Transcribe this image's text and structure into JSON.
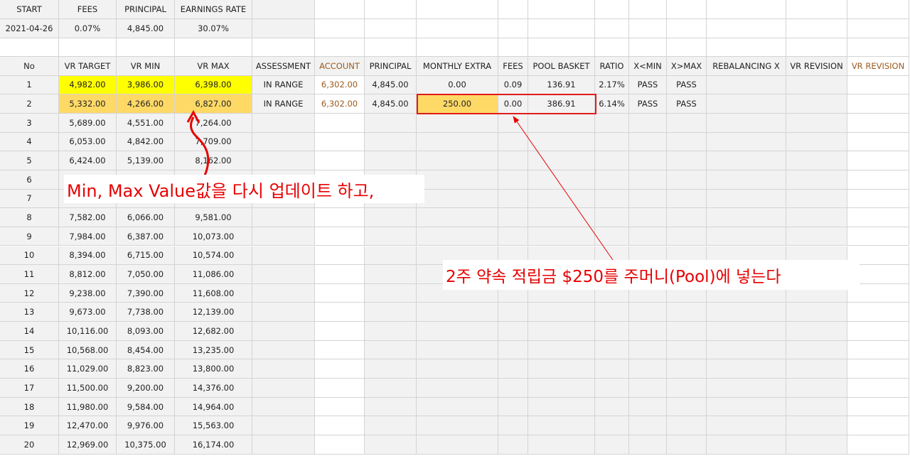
{
  "summary": {
    "headers": [
      "START",
      "FEES",
      "PRINCIPAL",
      "EARNINGS RATE"
    ],
    "values": [
      "2021-04-26",
      "0.07%",
      "4,845.00",
      "30.07%"
    ]
  },
  "table": {
    "headers": [
      "No",
      "VR TARGET",
      "VR MIN",
      "VR MAX",
      "ASSESSMENT",
      "ACCOUNT",
      "PRINCIPAL",
      "MONTHLY EXTRA",
      "FEES",
      "POOL BASKET",
      "RATIO",
      "X<MIN",
      "X>MAX",
      "REBALANCING X",
      "VR REVISION",
      "VR REVISION"
    ],
    "rows": [
      [
        "1",
        "4,982.00",
        "3,986.00",
        "6,398.00",
        "IN RANGE",
        "6,302.00",
        "4,845.00",
        "0.00",
        "0.09",
        "136.91",
        "2.17%",
        "PASS",
        "PASS",
        "",
        "",
        ""
      ],
      [
        "2",
        "5,332.00",
        "4,266.00",
        "6,827.00",
        "IN RANGE",
        "6,302.00",
        "4,845.00",
        "250.00",
        "0.00",
        "386.91",
        "6.14%",
        "PASS",
        "PASS",
        "",
        "",
        ""
      ],
      [
        "3",
        "5,689.00",
        "4,551.00",
        "7,264.00",
        "",
        "",
        "",
        "",
        "",
        "",
        "",
        "",
        "",
        "",
        "",
        ""
      ],
      [
        "4",
        "6,053.00",
        "4,842.00",
        "7,709.00",
        "",
        "",
        "",
        "",
        "",
        "",
        "",
        "",
        "",
        "",
        "",
        ""
      ],
      [
        "5",
        "6,424.00",
        "5,139.00",
        "8,162.00",
        "",
        "",
        "",
        "",
        "",
        "",
        "",
        "",
        "",
        "",
        "",
        ""
      ],
      [
        "6",
        "",
        "",
        "",
        "",
        "",
        "",
        "",
        "",
        "",
        "",
        "",
        "",
        "",
        "",
        ""
      ],
      [
        "7",
        "",
        "",
        "",
        "",
        "",
        "",
        "",
        "",
        "",
        "",
        "",
        "",
        "",
        "",
        ""
      ],
      [
        "8",
        "7,582.00",
        "6,066.00",
        "9,581.00",
        "",
        "",
        "",
        "",
        "",
        "",
        "",
        "",
        "",
        "",
        "",
        ""
      ],
      [
        "9",
        "7,984.00",
        "6,387.00",
        "10,073.00",
        "",
        "",
        "",
        "",
        "",
        "",
        "",
        "",
        "",
        "",
        "",
        ""
      ],
      [
        "10",
        "8,394.00",
        "6,715.00",
        "10,574.00",
        "",
        "",
        "",
        "",
        "",
        "",
        "",
        "",
        "",
        "",
        "",
        ""
      ],
      [
        "11",
        "8,812.00",
        "7,050.00",
        "11,086.00",
        "",
        "",
        "",
        "",
        "",
        "",
        "",
        "",
        "",
        "",
        "",
        ""
      ],
      [
        "12",
        "9,238.00",
        "7,390.00",
        "11,608.00",
        "",
        "",
        "",
        "",
        "",
        "",
        "",
        "",
        "",
        "",
        "",
        ""
      ],
      [
        "13",
        "9,673.00",
        "7,738.00",
        "12,139.00",
        "",
        "",
        "",
        "",
        "",
        "",
        "",
        "",
        "",
        "",
        "",
        ""
      ],
      [
        "14",
        "10,116.00",
        "8,093.00",
        "12,682.00",
        "",
        "",
        "",
        "",
        "",
        "",
        "",
        "",
        "",
        "",
        "",
        ""
      ],
      [
        "15",
        "10,568.00",
        "8,454.00",
        "13,235.00",
        "",
        "",
        "",
        "",
        "",
        "",
        "",
        "",
        "",
        "",
        "",
        ""
      ],
      [
        "16",
        "11,029.00",
        "8,823.00",
        "13,800.00",
        "",
        "",
        "",
        "",
        "",
        "",
        "",
        "",
        "",
        "",
        "",
        ""
      ],
      [
        "17",
        "11,500.00",
        "9,200.00",
        "14,376.00",
        "",
        "",
        "",
        "",
        "",
        "",
        "",
        "",
        "",
        "",
        "",
        ""
      ],
      [
        "18",
        "11,980.00",
        "9,584.00",
        "14,964.00",
        "",
        "",
        "",
        "",
        "",
        "",
        "",
        "",
        "",
        "",
        "",
        ""
      ],
      [
        "19",
        "12,470.00",
        "9,976.00",
        "15,563.00",
        "",
        "",
        "",
        "",
        "",
        "",
        "",
        "",
        "",
        "",
        "",
        ""
      ],
      [
        "20",
        "12,969.00",
        "10,375.00",
        "16,174.00",
        "",
        "",
        "",
        "",
        "",
        "",
        "",
        "",
        "",
        "",
        "",
        ""
      ]
    ]
  },
  "annotations": {
    "minmax_note": "Min, Max Value값을 다시 업데이트 하고,",
    "pool_note": "2주 약속 적립금 $250를 주머니(Pool)에 넣는다",
    "color": "#e60000"
  },
  "colors": {
    "highlight_yellow": "#ffff00",
    "highlight_orange": "#ffd966",
    "header_brown": "#9c5a1c",
    "grey_cell": "#f2f2f2"
  }
}
